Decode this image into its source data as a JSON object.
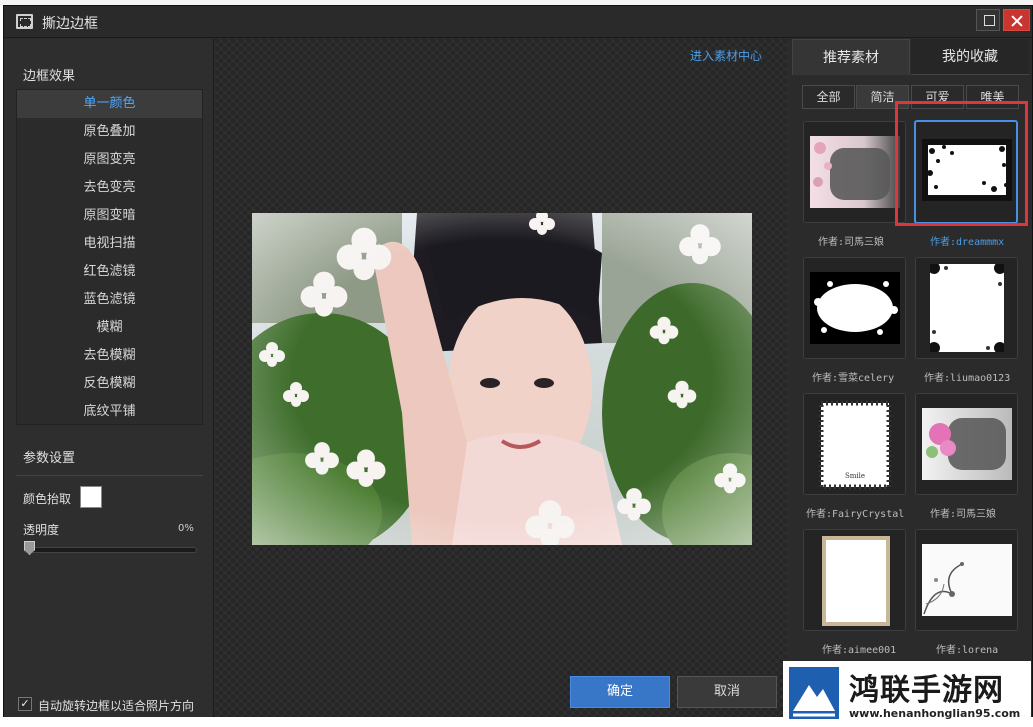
{
  "window": {
    "title": "撕边边框"
  },
  "left": {
    "effects_title": "边框效果",
    "effects": [
      "单一颜色",
      "原色叠加",
      "原图变亮",
      "去色变亮",
      "原图变暗",
      "电视扫描",
      "红色滤镜",
      "蓝色滤镜",
      "模糊",
      "去色模糊",
      "反色模糊",
      "底纹平铺"
    ],
    "params_title": "参数设置",
    "color_pick_label": "颜色抬取",
    "color_value": "#ffffff",
    "opacity_label": "透明度",
    "opacity_value": "0%",
    "opacity_fraction": 0,
    "auto_rotate_label": "自动旋转边框以适合照片方向",
    "auto_rotate_checked": true
  },
  "center": {
    "material_center_link": "进入素材中心",
    "ok_label": "确定",
    "cancel_label": "取消"
  },
  "right": {
    "tabs": [
      "推荐素材",
      "我的收藏"
    ],
    "subtabs": [
      "全部",
      "简洁",
      "可爱",
      "唯美"
    ],
    "active_subtab": "简洁",
    "thumbnails": [
      {
        "author": "作者:司馬三娘",
        "selected": false
      },
      {
        "author": "作者:dreammmx",
        "selected": true
      },
      {
        "author": "作者:雪菜celery",
        "selected": false
      },
      {
        "author": "作者:liumao0123",
        "selected": false
      },
      {
        "author": "作者:FairyCrystal",
        "selected": false
      },
      {
        "author": "作者:司馬三娘",
        "selected": false
      },
      {
        "author": "作者:aimee001",
        "selected": false
      },
      {
        "author": "作者:lorena",
        "selected": false
      }
    ]
  },
  "watermark": {
    "title": "鸿联手游网",
    "url": "www.henanhonglian95.com"
  },
  "accent_color": "#4a9ee8",
  "highlight_color": "#e0353a"
}
